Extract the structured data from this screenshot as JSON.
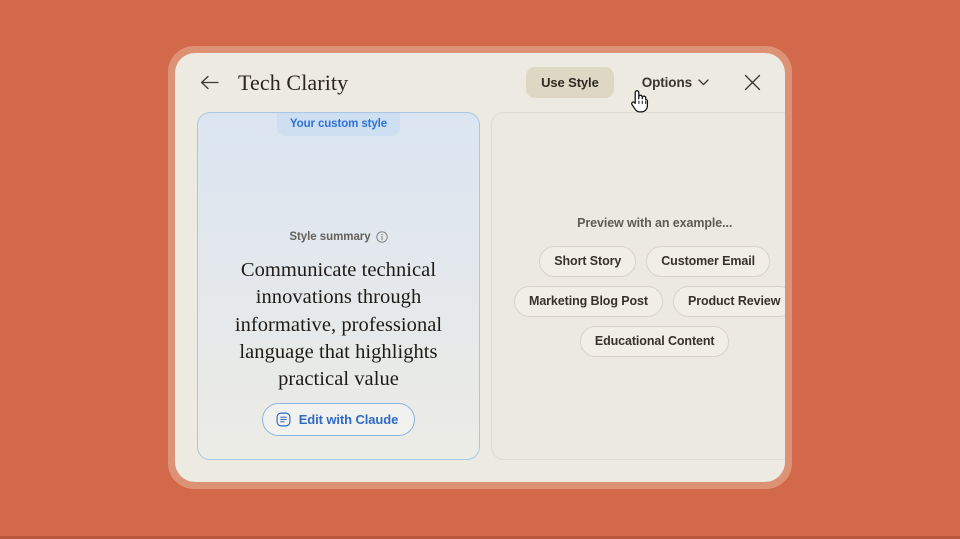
{
  "theme": {
    "background_color": "#d2694b",
    "frame_color": "#dd9276",
    "modal_color": "#edeae1",
    "accent_blue": "#2f72d6",
    "use_style_button_color": "#ded7c3"
  },
  "header": {
    "back_icon": "arrow-left-icon",
    "title": "Tech Clarity",
    "use_style_label": "Use Style",
    "options_label": "Options",
    "options_chevron_icon": "chevron-down-icon",
    "close_icon": "close-icon"
  },
  "style_card": {
    "badge": "Your custom style",
    "summary_label": "Style summary",
    "summary_info_icon": "info-icon",
    "summary_text": "Communicate technical innovations through informative, professional language that highlights practical value",
    "edit_button_label": "Edit with Claude",
    "edit_button_icon": "chat-bubble-icon"
  },
  "preview_card": {
    "label": "Preview with an example...",
    "chip_rows": [
      [
        "Short Story",
        "Customer Email"
      ],
      [
        "Marketing Blog Post",
        "Product Review"
      ],
      [
        "Educational Content"
      ]
    ]
  },
  "cursor": {
    "icon": "pointing-hand-cursor"
  }
}
